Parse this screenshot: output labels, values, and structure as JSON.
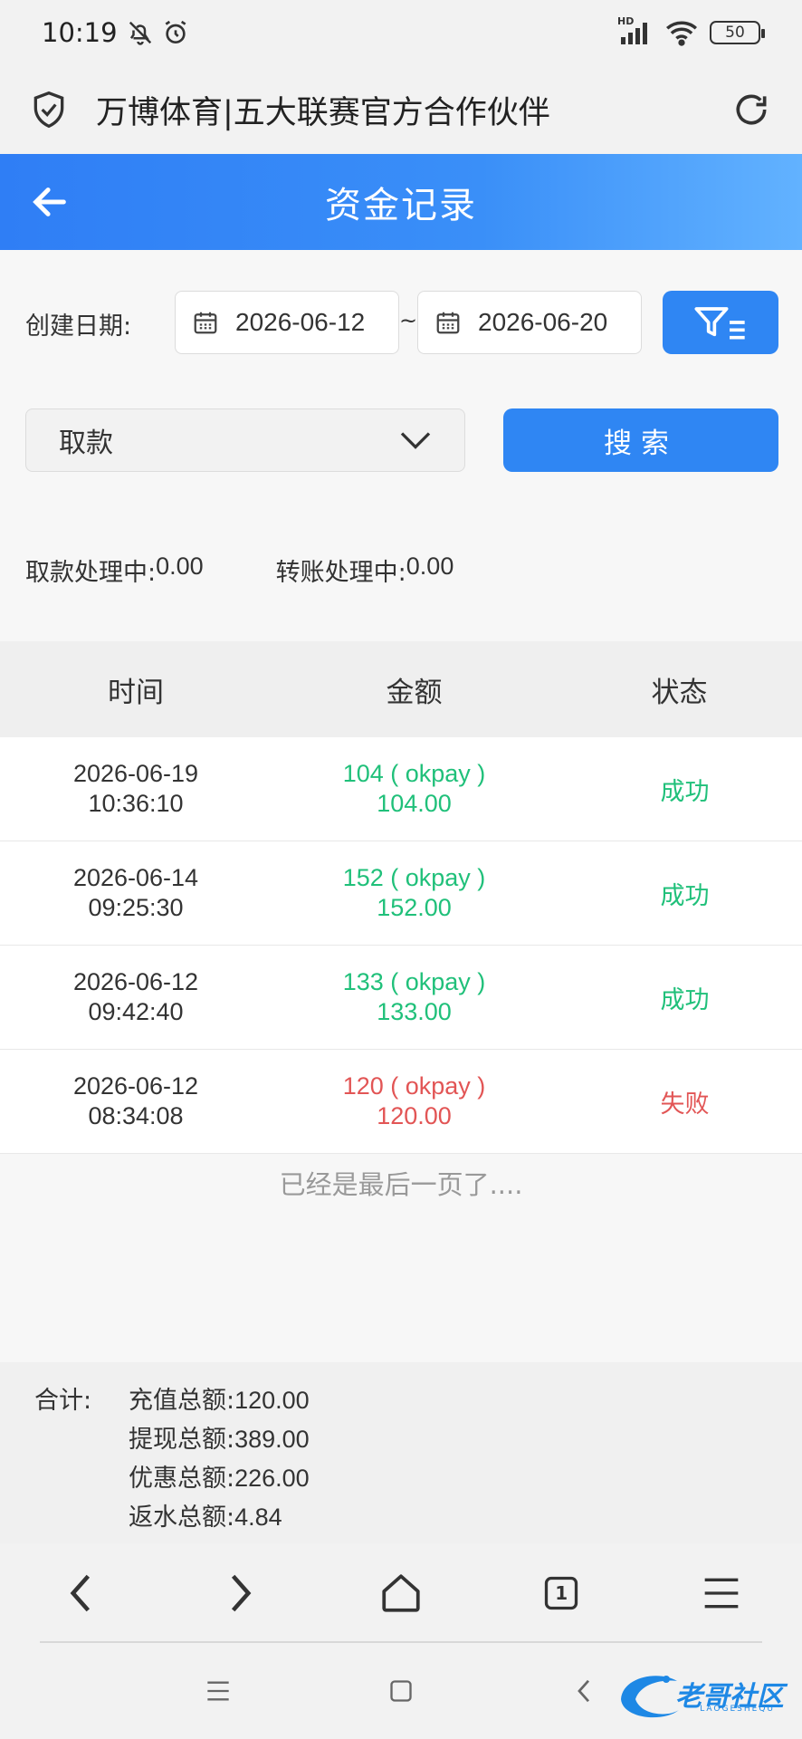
{
  "status_bar": {
    "time": "10:19",
    "network": "HD",
    "battery": "50"
  },
  "browser": {
    "title": "万博体育|五大联赛官方合作伙伴",
    "tab_count": "1"
  },
  "header": {
    "title": "资金记录"
  },
  "filters": {
    "date_label": "创建日期:",
    "start_date": "2026-06-12",
    "separator": "~",
    "end_date": "2026-06-20",
    "type_value": "取款",
    "search_label": "搜索"
  },
  "pending": {
    "withdraw_label": "取款处理中:",
    "withdraw_value": "0.00",
    "transfer_label": "转账处理中:",
    "transfer_value": "0.00"
  },
  "table": {
    "headers": [
      "时间",
      "金额",
      "状态"
    ],
    "rows": [
      {
        "date": "2026-06-19",
        "time": "10:36:10",
        "amount_line1": "104 ( okpay )",
        "amount_line2": "104.00",
        "status": "成功",
        "status_type": "success"
      },
      {
        "date": "2026-06-14",
        "time": "09:25:30",
        "amount_line1": "152 ( okpay )",
        "amount_line2": "152.00",
        "status": "成功",
        "status_type": "success"
      },
      {
        "date": "2026-06-12",
        "time": "09:42:40",
        "amount_line1": "133 ( okpay )",
        "amount_line2": "133.00",
        "status": "成功",
        "status_type": "success"
      },
      {
        "date": "2026-06-12",
        "time": "08:34:08",
        "amount_line1": "120 ( okpay )",
        "amount_line2": "120.00",
        "status": "失败",
        "status_type": "fail"
      }
    ],
    "end_message": "已经是最后一页了...."
  },
  "totals": {
    "label": "合计:",
    "recharge_label": "充值总额:",
    "recharge_value": "120.00",
    "withdraw_label": "提现总额:",
    "withdraw_value": "389.00",
    "discount_label": "优惠总额:",
    "discount_value": "226.00",
    "rebate_label": "返水总额:",
    "rebate_value": "4.84"
  },
  "watermark": {
    "text": "老哥社区",
    "sub": "LAOGESHEQU"
  },
  "colors": {
    "primary": "#2f86f3",
    "success": "#20c07a",
    "fail": "#e25555"
  }
}
